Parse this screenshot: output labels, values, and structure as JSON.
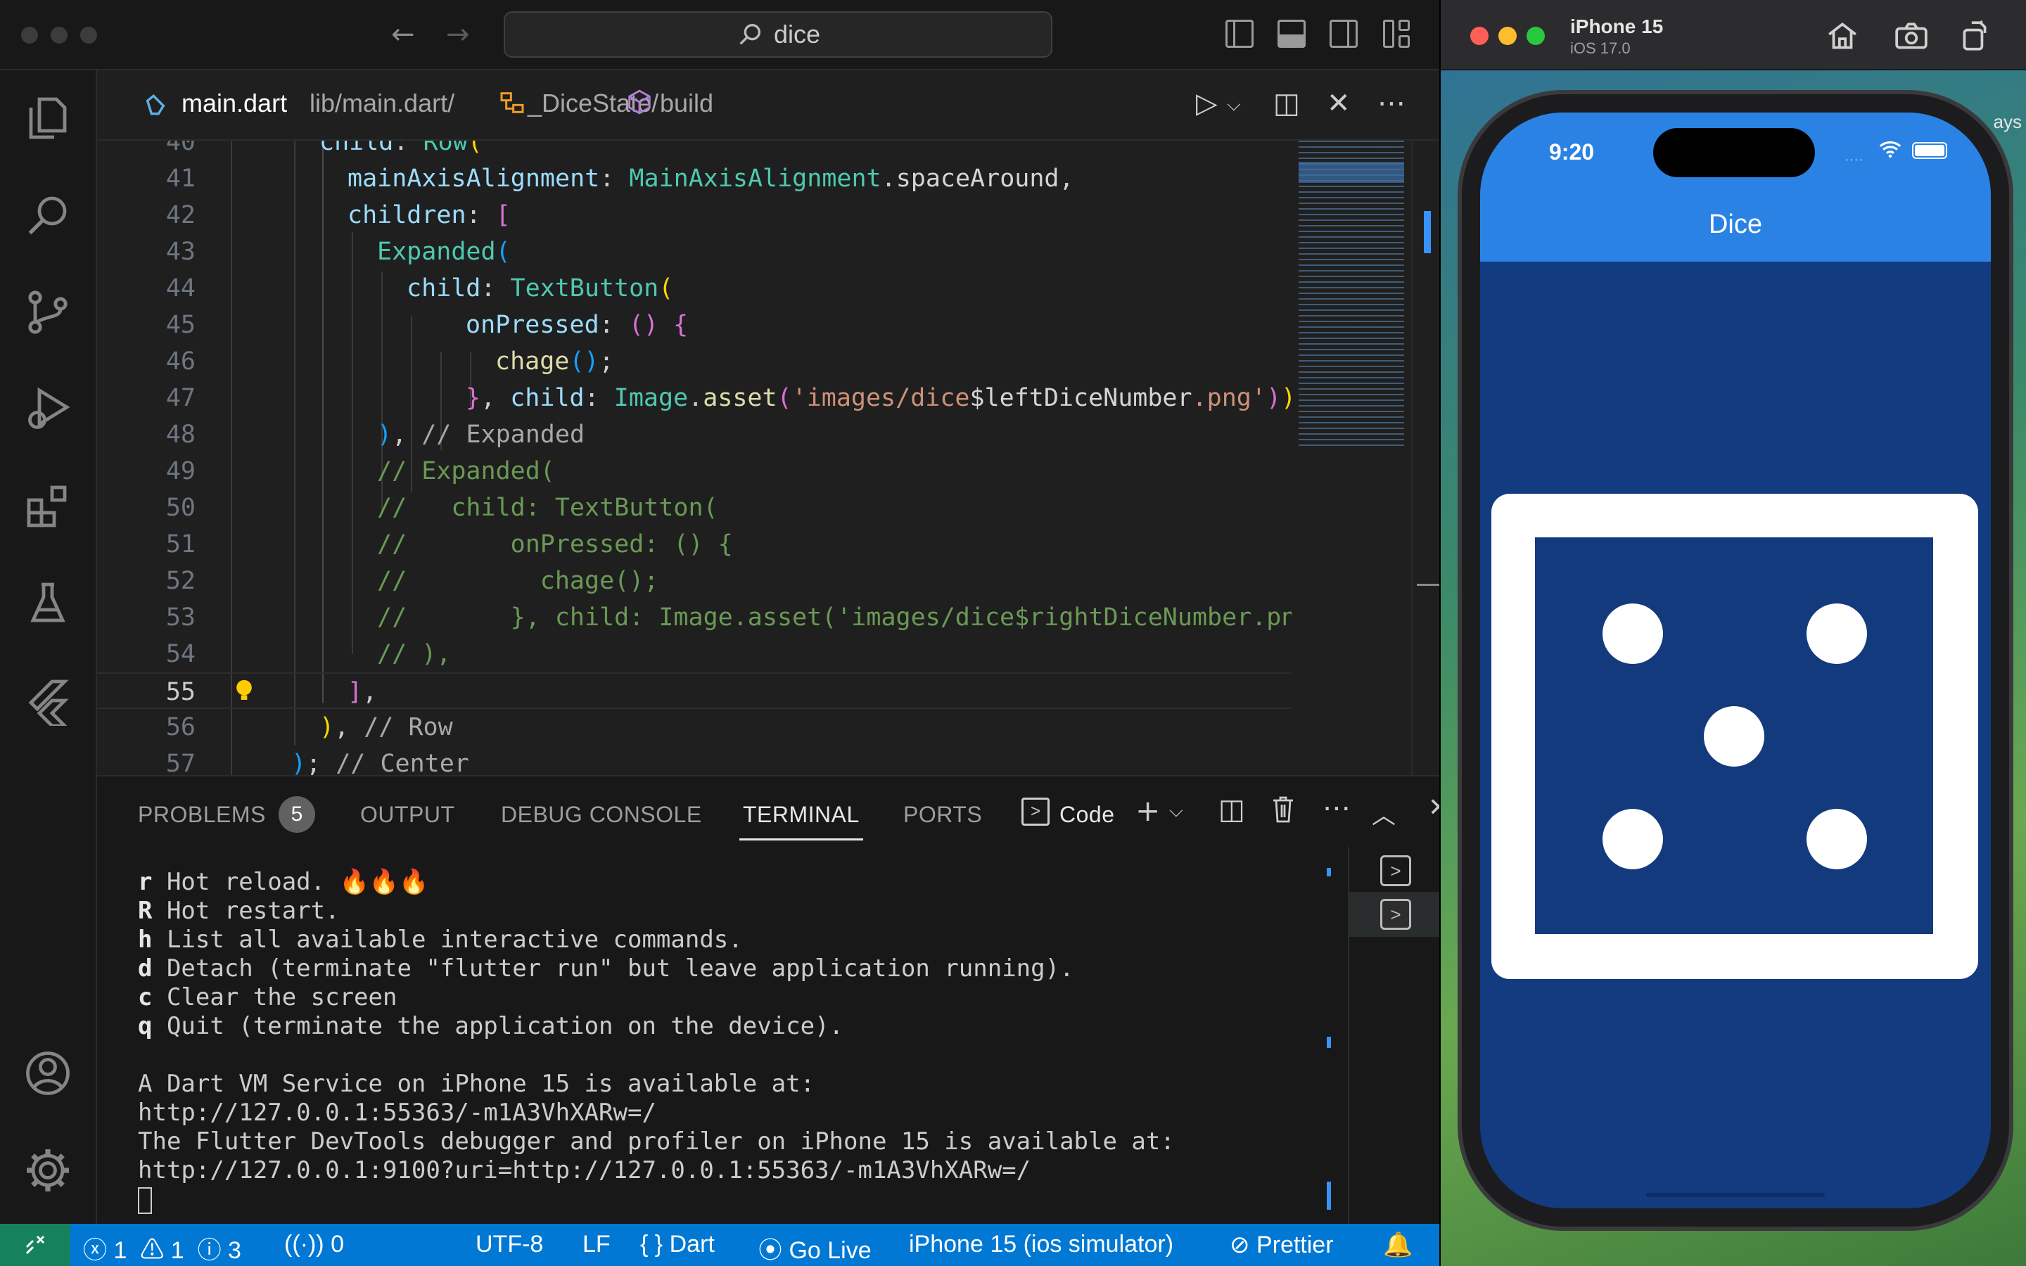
{
  "vscode": {
    "search": "dice",
    "breadcrumb": {
      "file": "main.dart",
      "path": "lib/main.dart/",
      "class": "_DiceState/",
      "method": "build"
    },
    "editor": {
      "lines": [
        {
          "n": "40",
          "text": "child: Row("
        },
        {
          "n": "41",
          "text": "mainAxisAlignment: MainAxisAlignment.spaceAround,"
        },
        {
          "n": "42",
          "text": "children: ["
        },
        {
          "n": "43",
          "text": "Expanded("
        },
        {
          "n": "44",
          "text": "child: TextButton("
        },
        {
          "n": "45",
          "text": "onPressed: () {"
        },
        {
          "n": "46",
          "text": "chage();"
        },
        {
          "n": "47",
          "text": "}, child: Image.asset('images/dice$leftDiceNumber.png')),"
        },
        {
          "n": "48",
          "text": "), // Expanded"
        },
        {
          "n": "49",
          "text": "// Expanded("
        },
        {
          "n": "50",
          "text": "//   child: TextButton("
        },
        {
          "n": "51",
          "text": "//       onPressed: () {"
        },
        {
          "n": "52",
          "text": "//         chage();"
        },
        {
          "n": "53",
          "text": "//       }, child: Image.asset('images/dice$rightDiceNumber.png"
        },
        {
          "n": "54",
          "text": "// ),"
        },
        {
          "n": "55",
          "text": "],"
        },
        {
          "n": "56",
          "text": "), // Row"
        },
        {
          "n": "57",
          "text": "); // Center"
        }
      ]
    },
    "panel": {
      "tabs": [
        "PROBLEMS",
        "OUTPUT",
        "DEBUG CONSOLE",
        "TERMINAL",
        "PORTS"
      ],
      "problems_count": "5",
      "active_tab": "TERMINAL",
      "terminal_profile": "Code",
      "terminal_lines": [
        {
          "key": "r",
          "text": " Hot reload. 🔥🔥🔥"
        },
        {
          "key": "R",
          "text": " Hot restart."
        },
        {
          "key": "h",
          "text": " List all available interactive commands."
        },
        {
          "key": "d",
          "text": " Detach (terminate \"flutter run\" but leave application running)."
        },
        {
          "key": "c",
          "text": " Clear the screen"
        },
        {
          "key": "q",
          "text": " Quit (terminate the application on the device)."
        },
        {
          "key": "",
          "text": ""
        },
        {
          "key": "",
          "text": "A Dart VM Service on iPhone 15 is available at:"
        },
        {
          "key": "",
          "text": "http://127.0.0.1:55363/-m1A3VhXARw=/"
        },
        {
          "key": "",
          "text": "The Flutter DevTools debugger and profiler on iPhone 15 is available at:"
        },
        {
          "key": "",
          "text": "http://127.0.0.1:9100?uri=http://127.0.0.1:55363/-m1A3VhXARw=/"
        }
      ]
    },
    "statusbar": {
      "errors": "1",
      "warnings": "1",
      "infos": "3",
      "ports": "0",
      "encoding": "UTF-8",
      "eol": "LF",
      "language": "Dart",
      "golive": "Go Live",
      "device": "iPhone 15 (ios simulator)",
      "prettier": "Prettier"
    }
  },
  "simulator": {
    "device": "iPhone 15",
    "os": "iOS 17.0",
    "time": "9:20",
    "app_title": "Dice",
    "dice_value": 5,
    "wallpaper_text": "ays"
  }
}
